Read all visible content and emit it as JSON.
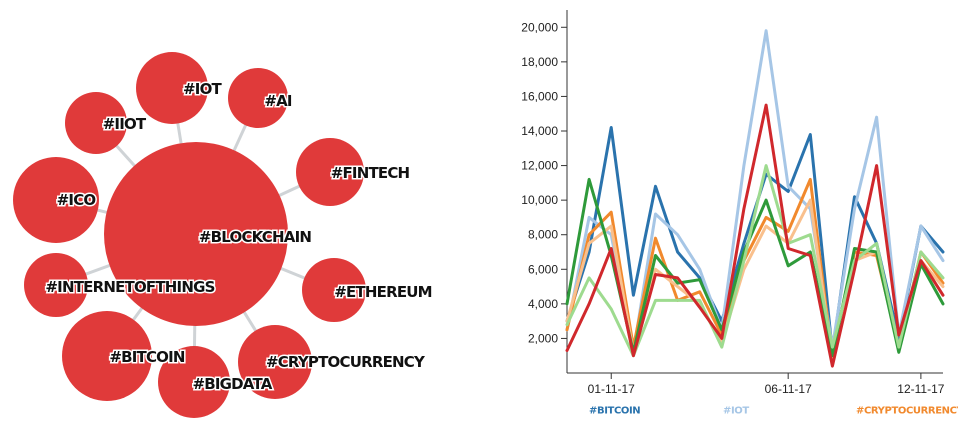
{
  "colors": {
    "bubble_fill": "#e03a3a",
    "link": "#cfd3d6",
    "series": [
      "#2a73ad",
      "#a6c6e6",
      "#f1892d",
      "#f9c08d",
      "#2e9a3a",
      "#9edb8f",
      "#d0282c"
    ]
  },
  "chart_data": [
    {
      "type": "network-bubble",
      "center": "#BLOCKCHAIN",
      "nodes": [
        {
          "label": "#BLOCKCHAIN",
          "size": 100
        },
        {
          "label": "#IOT",
          "size": 15
        },
        {
          "label": "#AI",
          "size": 9
        },
        {
          "label": "#IIOT",
          "size": 14
        },
        {
          "label": "#FINTECH",
          "size": 15
        },
        {
          "label": "#ICO",
          "size": 21
        },
        {
          "label": "#ETHEREUM",
          "size": 12
        },
        {
          "label": "#INTERNETOFTHINGS",
          "size": 13
        },
        {
          "label": "#CRYPTOCURRENCY",
          "size": 18
        },
        {
          "label": "#BITCOIN",
          "size": 27
        },
        {
          "label": "#BIGDATA",
          "size": 14
        }
      ]
    },
    {
      "type": "line",
      "x_tick_labels": [
        "01-11-17",
        "06-11-17",
        "12-11-17"
      ],
      "ylim": [
        0,
        21000
      ],
      "y_ticks": [
        2000,
        4000,
        6000,
        8000,
        10000,
        12000,
        14000,
        16000,
        18000,
        20000
      ],
      "y_tick_labels": [
        "2,000",
        "4,000",
        "6,000",
        "8,000",
        "10,000",
        "12,000",
        "14,000",
        "16,000",
        "18,000",
        "20,000"
      ],
      "legend": [
        "#BITCOIN",
        "#IOT",
        "#CRYPTOCURRENCY"
      ],
      "series": [
        {
          "name": "#BITCOIN",
          "values": [
            3000,
            7000,
            14200,
            4500,
            10800,
            7000,
            5500,
            3000,
            7500,
            11500,
            10500,
            13800,
            1200,
            10200,
            7500,
            2000,
            8500,
            7000
          ]
        },
        {
          "name": "#IOT",
          "values": [
            2500,
            9000,
            8000,
            1200,
            9200,
            8000,
            6000,
            2500,
            12000,
            19800,
            10800,
            9500,
            1500,
            9500,
            14800,
            2200,
            8500,
            6500
          ]
        },
        {
          "name": "#CRYPTOCURRENCY",
          "values": [
            2500,
            8000,
            9300,
            1500,
            7800,
            4200,
            4700,
            2200,
            6500,
            9000,
            8200,
            11200,
            800,
            7000,
            6800,
            1500,
            7000,
            5200
          ]
        },
        {
          "values": [
            3000,
            7500,
            8500,
            1200,
            6000,
            5000,
            4000,
            1800,
            6000,
            8500,
            7500,
            10000,
            800,
            6500,
            7000,
            1500,
            6500,
            5000
          ]
        },
        {
          "values": [
            4000,
            11200,
            6800,
            1200,
            6800,
            5200,
            5400,
            2500,
            7000,
            10000,
            6200,
            7000,
            1000,
            7200,
            7000,
            1200,
            6300,
            4000
          ]
        },
        {
          "values": [
            2800,
            5500,
            3700,
            1000,
            4200,
            4200,
            4200,
            1500,
            6500,
            12000,
            7500,
            8000,
            1500,
            6500,
            7500,
            1500,
            7000,
            5500
          ]
        },
        {
          "values": [
            1300,
            4000,
            7200,
            1000,
            5700,
            5500,
            3800,
            2000,
            9500,
            15500,
            7200,
            6800,
            400,
            6000,
            12000,
            2200,
            6500,
            4500
          ]
        }
      ]
    }
  ]
}
